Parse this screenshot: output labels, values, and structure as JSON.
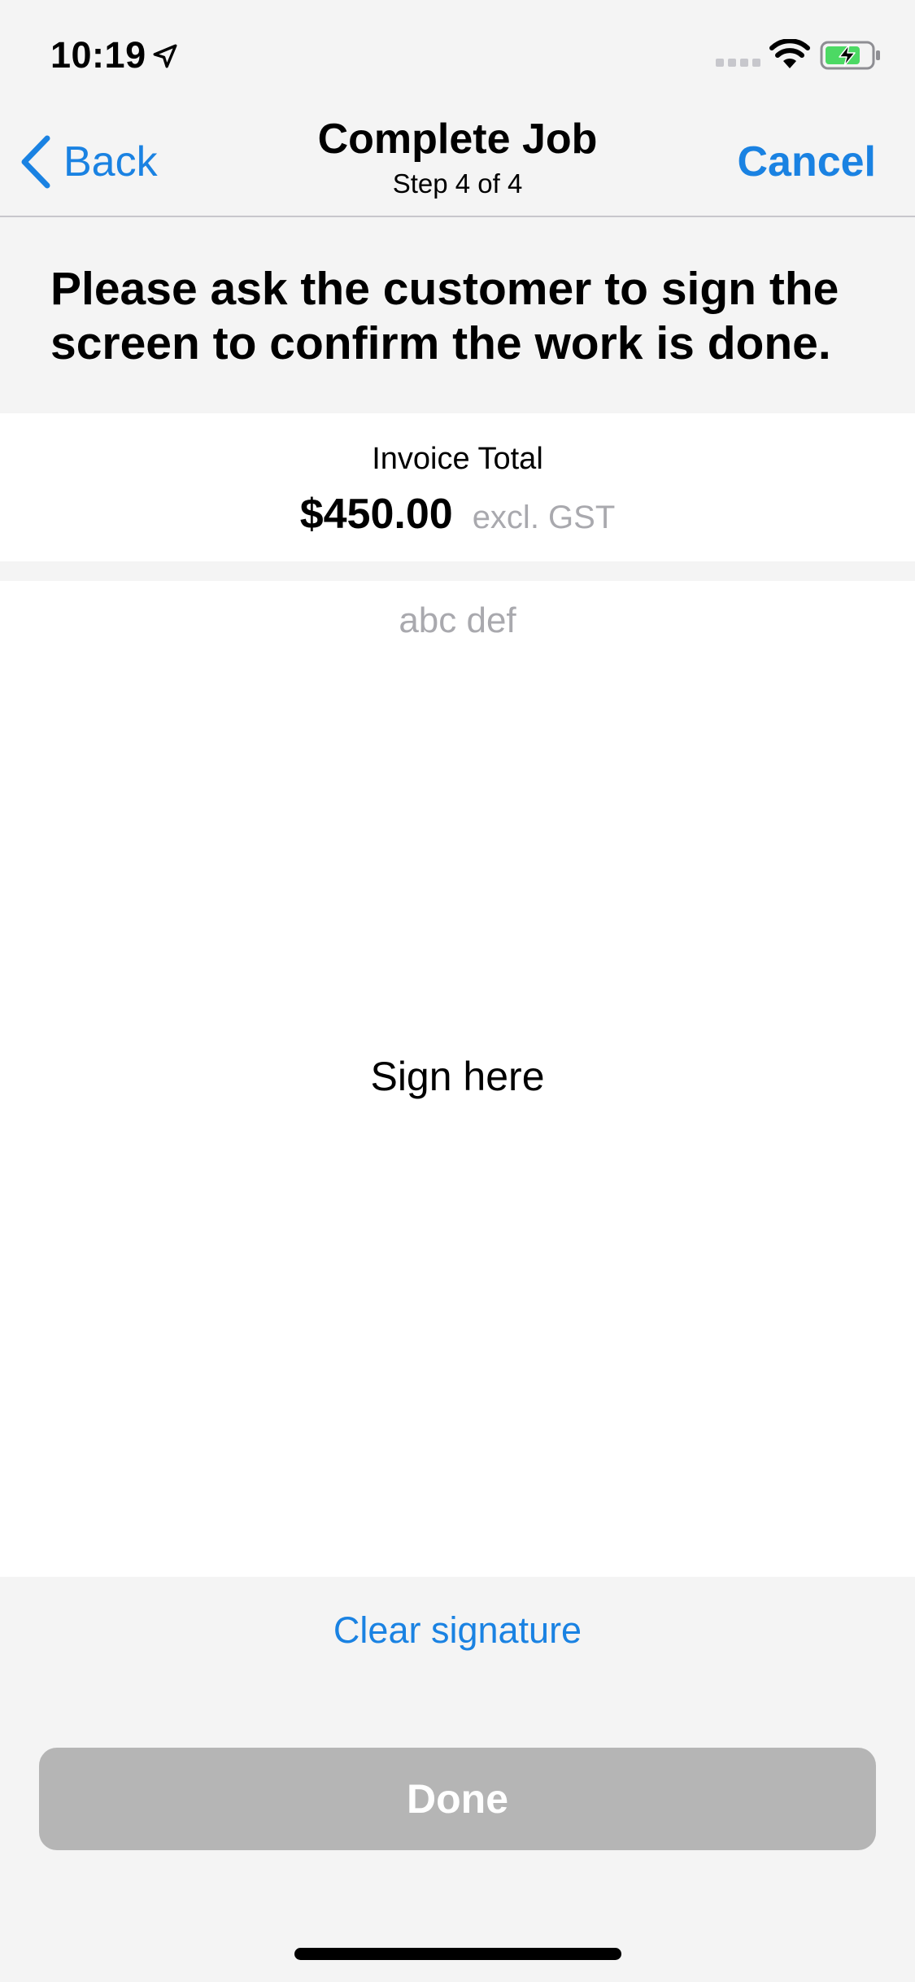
{
  "status_bar": {
    "time": "10:19",
    "icons": [
      "location-arrow-icon",
      "cellular-signal-icon",
      "wifi-icon",
      "battery-charging-icon"
    ]
  },
  "nav": {
    "back_label": "Back",
    "title": "Complete Job",
    "subtitle": "Step 4 of 4",
    "cancel_label": "Cancel"
  },
  "instruction": "Please ask the customer to sign the screen to confirm the work is done.",
  "invoice": {
    "label": "Invoice Total",
    "amount": "$450.00",
    "note": "excl. GST"
  },
  "signature": {
    "signer_name": "abc def",
    "placeholder": "Sign here",
    "clear_label": "Clear signature"
  },
  "actions": {
    "done_label": "Done"
  },
  "colors": {
    "accent": "#1a82e2",
    "done_disabled": "#b5b5b5",
    "background": "#f4f4f4",
    "battery": "#4cd964"
  }
}
